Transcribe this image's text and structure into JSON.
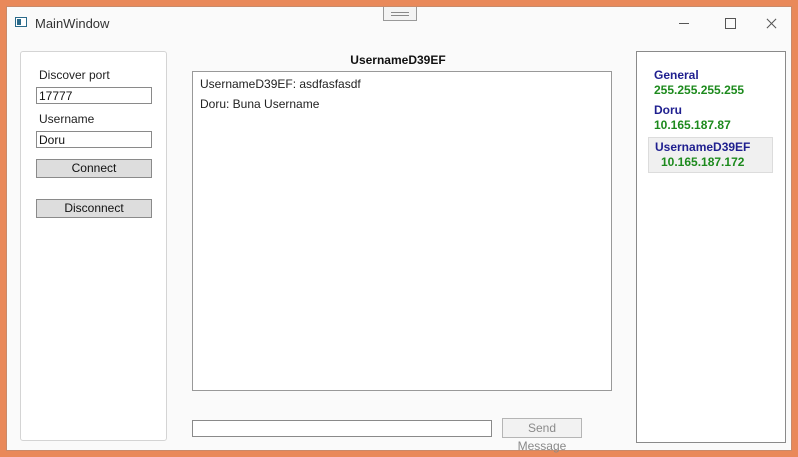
{
  "window": {
    "title": "MainWindow"
  },
  "left_panel": {
    "discover_port_label": "Discover port",
    "discover_port_value": "17777",
    "username_label": "Username",
    "username_value": "Doru",
    "connect_label": "Connect",
    "disconnect_label": "Disconnect"
  },
  "chat": {
    "title": "UsernameD39EF",
    "messages": [
      "UsernameD39EF: asdfasfasdf",
      "Doru: Buna Username"
    ],
    "input_value": "",
    "send_label": "Send Message"
  },
  "users": [
    {
      "name": "General",
      "ip": "255.255.255.255",
      "selected": false
    },
    {
      "name": "Doru",
      "ip": "10.165.187.87",
      "selected": false
    },
    {
      "name": "UsernameD39EF",
      "ip": "10.165.187.172",
      "selected": true
    }
  ],
  "colors": {
    "user_name": "#1f1f8f",
    "user_ip": "#1d8a1d",
    "desktop_bg": "#e9895a"
  }
}
